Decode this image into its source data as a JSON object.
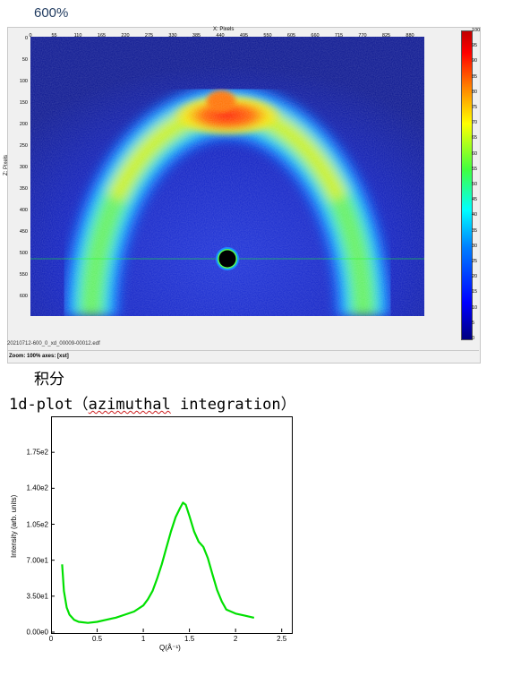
{
  "viewer": {
    "heading": "600%",
    "x_axis_title": "X: Pixels",
    "y_axis_title": "Z: Pixels",
    "x_ticks": [
      "0",
      "55",
      "110",
      "165",
      "220",
      "275",
      "330",
      "385",
      "440",
      "495",
      "550",
      "605",
      "660",
      "715",
      "770",
      "825",
      "880"
    ],
    "y_ticks": [
      "0",
      "50",
      "100",
      "150",
      "200",
      "250",
      "300",
      "350",
      "400",
      "450",
      "500",
      "550",
      "600"
    ],
    "colorbar_ticks": [
      "100",
      "95",
      "90",
      "85",
      "80",
      "75",
      "70",
      "65",
      "60",
      "55",
      "50",
      "45",
      "40",
      "35",
      "30",
      "25",
      "20",
      "15",
      "10",
      "5",
      "0"
    ],
    "filename": "20210712-600_0_xd_00009-00012.edf",
    "status": "Zoom: 100%   axes: [xst]",
    "colormap": [
      "#00007f",
      "#0000ff",
      "#0080ff",
      "#00ffff",
      "#80ff80",
      "#ffff00",
      "#ff8000",
      "#ff0000",
      "#7f0000"
    ]
  },
  "integration": {
    "heading_cn": "积分",
    "heading_prefix": "1d-plot（",
    "heading_underlined": "azimuthal",
    "heading_suffix": " integration）"
  },
  "chart_data": {
    "type": "line",
    "title": "",
    "xlabel": "Q(Å⁻¹)",
    "ylabel": "Intensity (arb. units)",
    "xlim": [
      0,
      2.6
    ],
    "ylim": [
      0,
      210
    ],
    "x_ticks": [
      "0",
      "0.5",
      "1",
      "1.5",
      "2",
      "2.5"
    ],
    "y_ticks": [
      "0.00e0",
      "3.50e1",
      "7.00e1",
      "1.05e2",
      "1.40e2",
      "1.75e2"
    ],
    "line_color": "#00e000",
    "series": [
      {
        "x": [
          0.12,
          0.14,
          0.17,
          0.2,
          0.25,
          0.3,
          0.4,
          0.5,
          0.6,
          0.7,
          0.8,
          0.9,
          1.0,
          1.05,
          1.1,
          1.15,
          1.2,
          1.25,
          1.3,
          1.35,
          1.4,
          1.43,
          1.46,
          1.5,
          1.55,
          1.6,
          1.65,
          1.7,
          1.75,
          1.8,
          1.85,
          1.9,
          2.0,
          2.1,
          2.2
        ],
        "y": [
          66,
          40,
          24,
          17,
          12,
          10,
          9,
          10,
          12,
          14,
          17,
          20,
          26,
          32,
          40,
          52,
          66,
          82,
          98,
          112,
          121,
          126,
          124,
          113,
          98,
          88,
          83,
          72,
          56,
          41,
          30,
          22,
          18,
          16,
          14
        ]
      }
    ]
  }
}
